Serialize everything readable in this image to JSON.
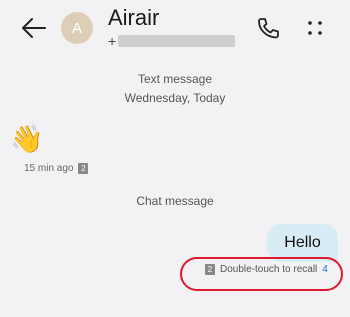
{
  "header": {
    "back_icon": "arrow-left-icon",
    "avatar_letter": "A",
    "contact_name": "Airair",
    "number_prefix": "+",
    "call_icon": "phone-icon",
    "more_icon": "more-dots-icon"
  },
  "conversation": {
    "text_section_label": "Text message",
    "date_label": "Wednesday, Today",
    "incoming_emoji": "👋",
    "incoming_time": "15 min ago",
    "incoming_sim": "2",
    "chat_section_label": "Chat message",
    "outgoing_text": "Hello",
    "outgoing_sim": "2",
    "recall_text": "Double-touch to recall",
    "recall_count": "4"
  },
  "colors": {
    "background": "#f2f2f4",
    "avatar": "#dccfb6",
    "outgoing_bubble": "#d8ecf5",
    "highlight": "#e0182c",
    "link": "#2a6ad8"
  }
}
